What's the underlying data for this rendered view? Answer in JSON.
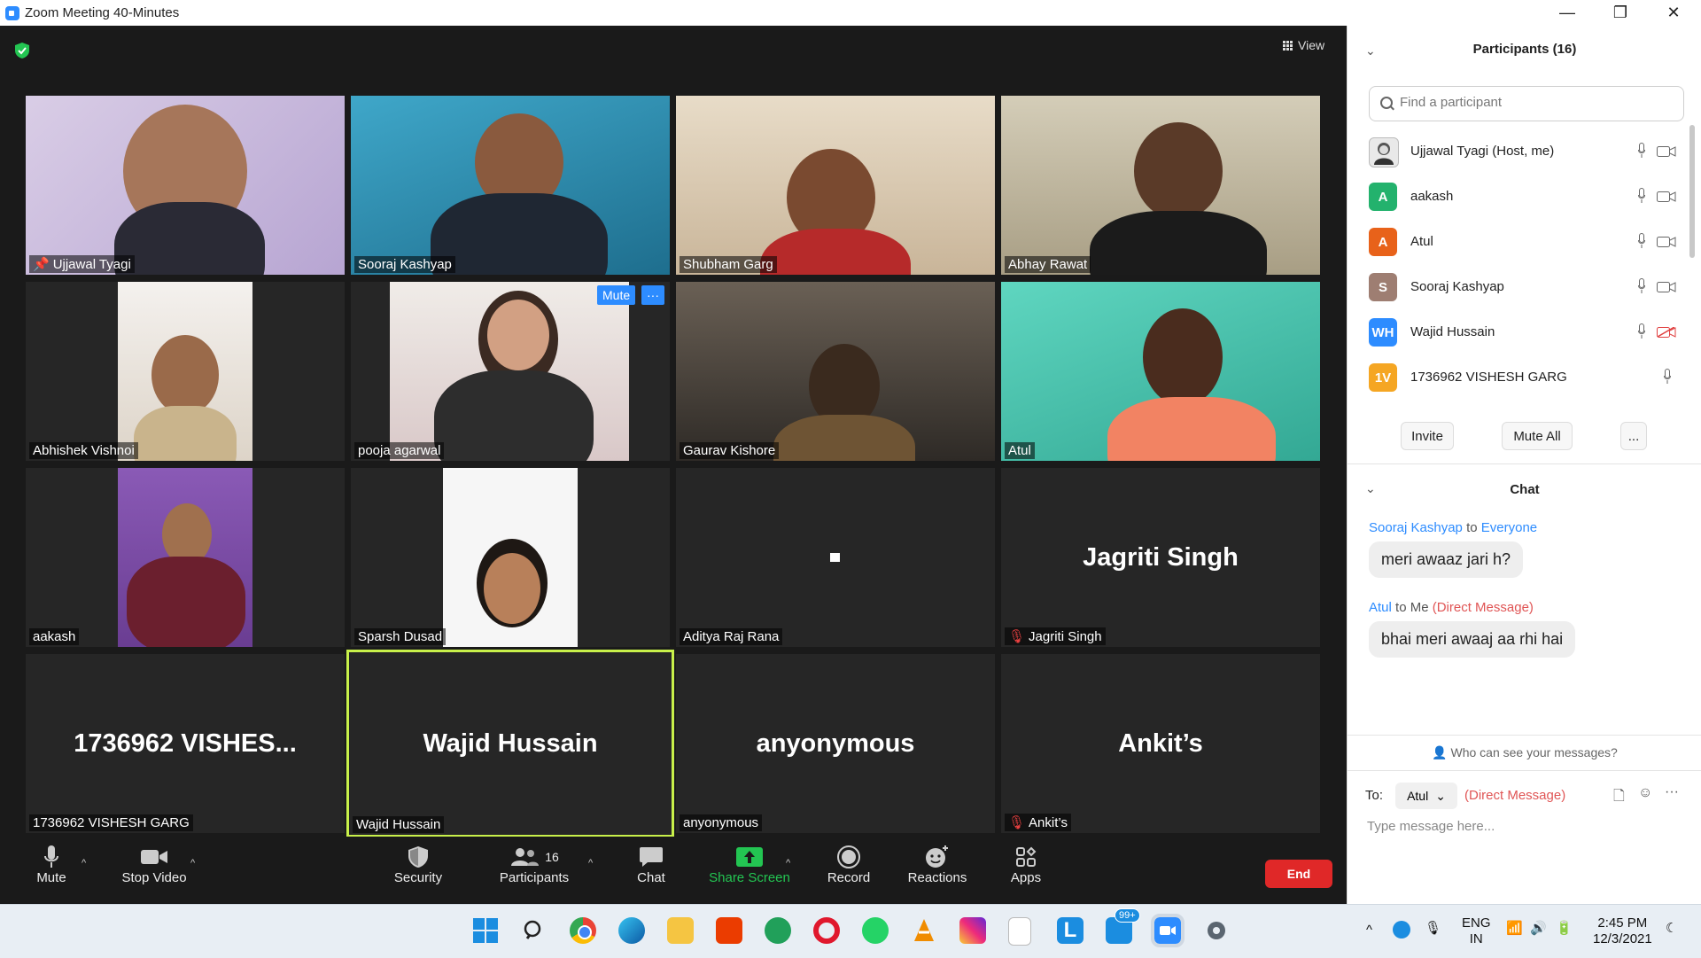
{
  "window": {
    "title": "Zoom Meeting 40-Minutes"
  },
  "meeting": {
    "view_label": "View"
  },
  "tiles": [
    {
      "name": "Ujjawal Tyagi"
    },
    {
      "name": "Sooraj Kashyap"
    },
    {
      "name": "Shubham Garg"
    },
    {
      "name": "Abhay Rawat"
    },
    {
      "name": "Abhishek Vishnoi"
    },
    {
      "name": "pooja agarwal",
      "mute_label": "Mute",
      "more_label": "···"
    },
    {
      "name": "Gaurav Kishore"
    },
    {
      "name": "Atul"
    },
    {
      "name": "aakash"
    },
    {
      "name": "Sparsh Dusad"
    },
    {
      "name": "Aditya Raj Rana"
    },
    {
      "name": "Jagriti Singh",
      "big": "Jagriti Singh"
    },
    {
      "name": "1736962 VISHESH GARG",
      "big": "1736962  VISHES..."
    },
    {
      "name": "Wajid Hussain",
      "big": "Wajid Hussain"
    },
    {
      "name": "anyonymous",
      "big": "anyonymous"
    },
    {
      "name": "Ankit’s",
      "big": "Ankit’s"
    }
  ],
  "toolbar": {
    "mute": "Mute",
    "stop_video": "Stop Video",
    "security": "Security",
    "participants": "Participants",
    "participants_count": "16",
    "chat": "Chat",
    "share_screen": "Share Screen",
    "record": "Record",
    "reactions": "Reactions",
    "apps": "Apps",
    "end": "End"
  },
  "panel": {
    "participants_title": "Participants (16)",
    "search_placeholder": "Find a participant",
    "participants": [
      {
        "name": "Ujjawal Tyagi (Host, me)",
        "initials": "",
        "color": "#888888"
      },
      {
        "name": "aakash",
        "initials": "A",
        "color": "#23B26D"
      },
      {
        "name": "Atul",
        "initials": "A",
        "color": "#E8621A"
      },
      {
        "name": "Sooraj Kashyap",
        "initials": "S",
        "color": "#9E7E72"
      },
      {
        "name": "Wajid Hussain",
        "initials": "WH",
        "color": "#2D8CFF"
      },
      {
        "name": "1736962 VISHESH GARG",
        "initials": "1V",
        "color": "#F5A623"
      }
    ],
    "invite": "Invite",
    "mute_all": "Mute All",
    "more": "...",
    "chat_title": "Chat",
    "messages": [
      {
        "from": "Sooraj Kashyap",
        "to_word": "to",
        "to": "Everyone",
        "text": "meri awaaz jari h?"
      },
      {
        "from": "Atul",
        "to_word": "to Me",
        "to": "(Direct Message)",
        "text": "bhai meri awaaj aa rhi hai"
      }
    ],
    "who_can_see": "Who can see your messages?",
    "to_label": "To:",
    "to_value": "Atul",
    "direct_message": "(Direct Message)",
    "type_placeholder": "Type message here..."
  },
  "taskbar": {
    "language": "ENG",
    "region": "IN",
    "time": "2:45 PM",
    "date": "12/3/2021",
    "badge": "99+"
  }
}
